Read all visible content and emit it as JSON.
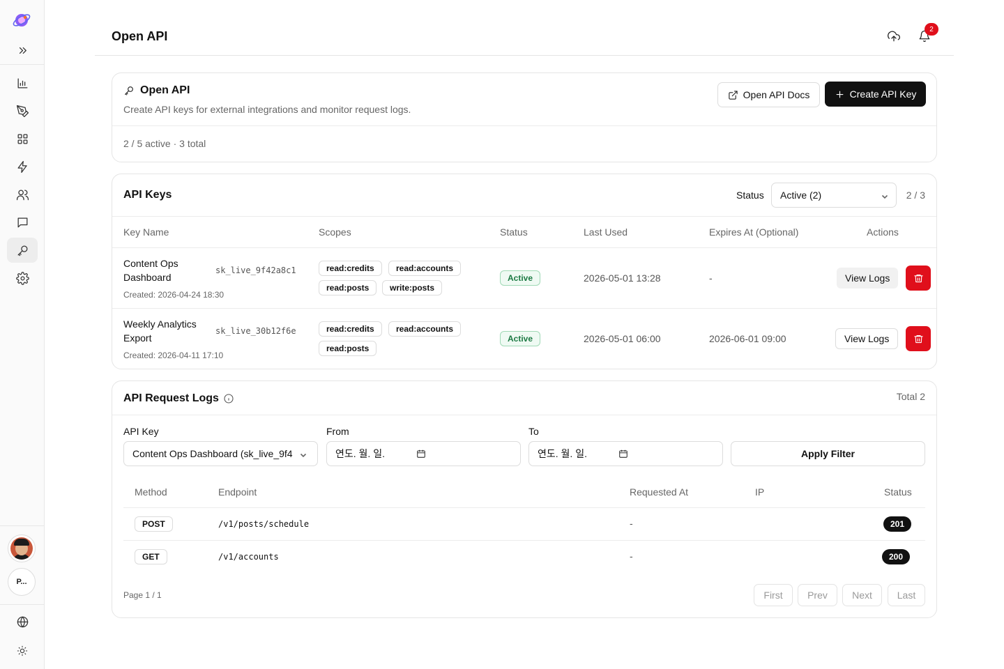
{
  "app": {
    "brand_color": "#7c3aed"
  },
  "sidebar": {
    "items": [
      {
        "name": "sidebar-item-analytics",
        "icon": "bar-chart-icon"
      },
      {
        "name": "sidebar-item-compose",
        "icon": "pen-tool-icon"
      },
      {
        "name": "sidebar-item-apps",
        "icon": "grid-icon"
      },
      {
        "name": "sidebar-item-automation",
        "icon": "lightning-icon"
      },
      {
        "name": "sidebar-item-users",
        "icon": "users-icon"
      },
      {
        "name": "sidebar-item-messages",
        "icon": "message-icon"
      },
      {
        "name": "sidebar-item-open-api",
        "icon": "key-icon",
        "active": true
      },
      {
        "name": "sidebar-item-settings",
        "icon": "gear-icon"
      }
    ],
    "workspace_label": "P..."
  },
  "header": {
    "title": "Open API",
    "notification_count": "2"
  },
  "overview": {
    "title": "Open API",
    "description": "Create API keys for external integrations and monitor request logs.",
    "summary": "2 / 5 active · 3 total",
    "docs_button": "Open API Docs",
    "create_button": "Create API Key"
  },
  "api_keys": {
    "title": "API Keys",
    "status_label": "Status",
    "status_selected": "Active (2)",
    "count": "2 / 3",
    "columns": [
      "Key Name",
      "Scopes",
      "Status",
      "Last Used",
      "Expires At (Optional)",
      "Actions"
    ],
    "rows": [
      {
        "name_line1": "Content Ops",
        "name_line2": "Dashboard",
        "prefix": "sk_live_9f42a8c1",
        "created": "Created: 2026-04-24 18:30",
        "scopes": [
          "read:credits",
          "read:accounts",
          "read:posts",
          "write:posts"
        ],
        "status": "Active",
        "last_used": "2026-05-01 13:28",
        "expires": "-",
        "view_logs": "View Logs"
      },
      {
        "name_line1": "Weekly Analytics",
        "name_line2": "Export",
        "prefix": "sk_live_30b12f6e",
        "created": "Created: 2026-04-11 17:10",
        "scopes": [
          "read:credits",
          "read:accounts",
          "read:posts"
        ],
        "status": "Active",
        "last_used": "2026-05-01 06:00",
        "expires": "2026-06-01 09:00",
        "view_logs": "View Logs"
      }
    ]
  },
  "logs": {
    "title": "API Request Logs",
    "total": "Total 2",
    "filters": {
      "key_label": "API Key",
      "key_selected": "Content Ops Dashboard (sk_live_9f4",
      "from_label": "From",
      "from_value": "연도. 월. 일.",
      "to_label": "To",
      "to_value": "연도. 월. 일.",
      "apply": "Apply Filter"
    },
    "columns": [
      "Method",
      "Endpoint",
      "Requested At",
      "IP",
      "Status"
    ],
    "rows": [
      {
        "method": "POST",
        "endpoint": "/v1/posts/schedule",
        "requested_at": "-",
        "ip": "",
        "status": "201"
      },
      {
        "method": "GET",
        "endpoint": "/v1/accounts",
        "requested_at": "-",
        "ip": "",
        "status": "200"
      }
    ],
    "page_info": "Page 1 / 1",
    "pagination": [
      "First",
      "Prev",
      "Next",
      "Last"
    ]
  }
}
